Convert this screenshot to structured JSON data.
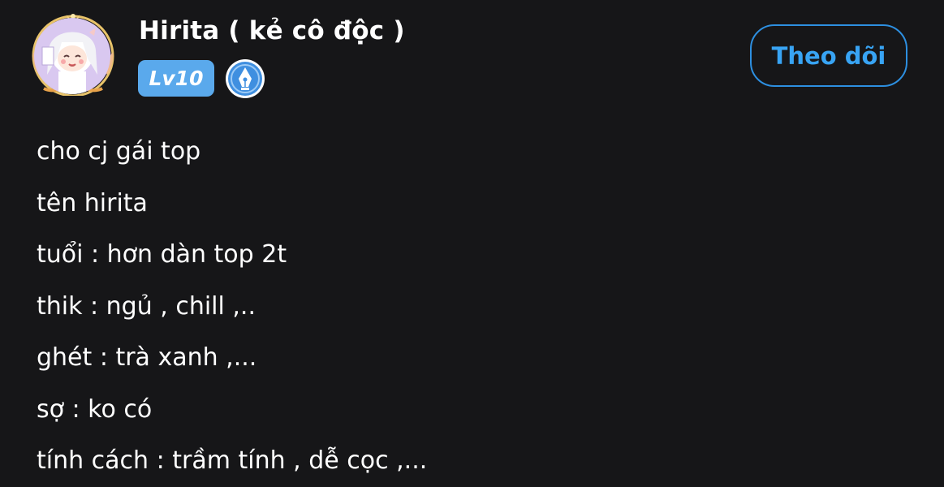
{
  "post": {
    "author": {
      "name": "Hirita ( kẻ cô độc )",
      "level": "Lv10",
      "avatar_icon": "anime-girl-avatar-icon",
      "role_icon": "pen-nib-badge-icon"
    },
    "follow_label": "Theo dõi",
    "lines": [
      "cho cj gái top",
      "tên hirita",
      "tuổi : hơn dàn top 2t",
      "thik : ngủ , chill ,..",
      "ghét : trà xanh ,...",
      "sợ : ko có",
      "tính cách : trầm tính , dễ cọc ,..."
    ]
  },
  "colors": {
    "background": "#161618",
    "accent": "#2d8fe0",
    "level_badge": "#5aa9ec",
    "text": "#ffffff"
  }
}
